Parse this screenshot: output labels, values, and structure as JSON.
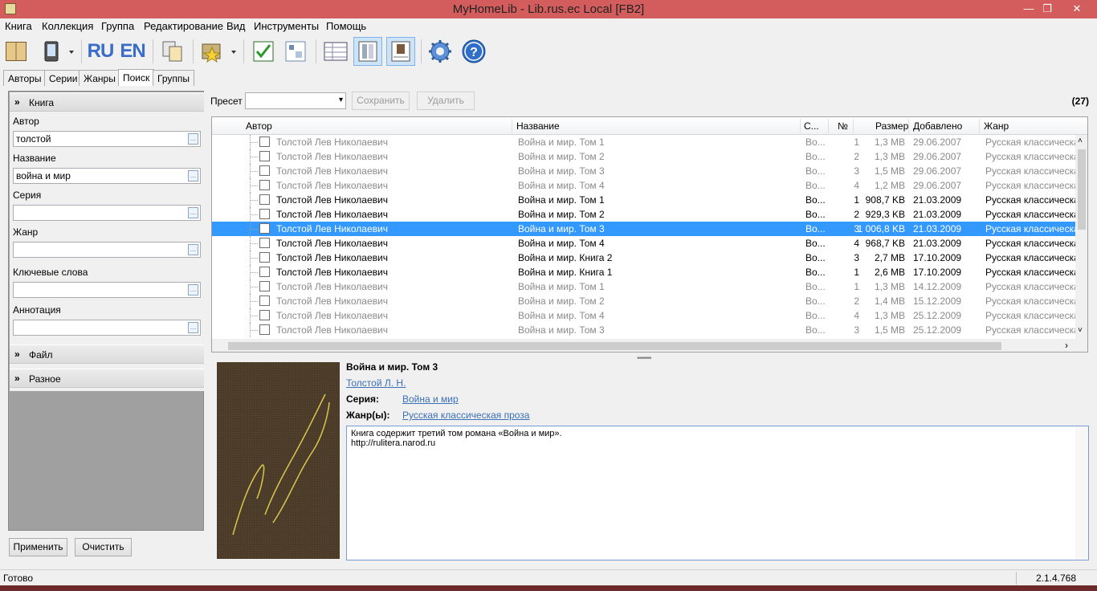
{
  "window": {
    "title": "MyHomeLib - Lib.rus.ec Local [FB2]",
    "btn_min": "—",
    "btn_max": "❐",
    "btn_close": "✕"
  },
  "menu": [
    "Книга",
    "Коллекция",
    "Группа",
    "Редактирование",
    "Вид",
    "Инструменты",
    "Помощь"
  ],
  "toolbar": {
    "lang_ru": "RU",
    "lang_en": "EN"
  },
  "tabs": [
    "Авторы",
    "Серии",
    "Жанры",
    "Поиск",
    "Группы"
  ],
  "search_panel": {
    "section_book": "Книга",
    "fields": [
      {
        "label": "Автор",
        "value": "толстой"
      },
      {
        "label": "Название",
        "value": "война и мир"
      },
      {
        "label": "Серия",
        "value": ""
      },
      {
        "label": "Жанр",
        "value": ""
      },
      {
        "label": "Ключевые слова",
        "value": ""
      },
      {
        "label": "Аннотация",
        "value": ""
      }
    ],
    "section_file": "Файл",
    "section_misc": "Разное",
    "apply": "Применить",
    "clear": "Очистить"
  },
  "preset": {
    "label": "Пресет",
    "value": "",
    "save": "Сохранить",
    "delete": "Удалить",
    "count": "(27)"
  },
  "grid": {
    "columns": [
      "Автор",
      "Название",
      "С...",
      "№",
      "Размер",
      "Добавлено",
      "Жанр"
    ],
    "rows": [
      {
        "author": "Толстой Лев Николаевич",
        "title": "Война и мир. Том 1",
        "series": "Во...",
        "no": "1",
        "size": "1,3 MB",
        "added": "29.06.2007",
        "genre": "Русская классическая",
        "state": "dim"
      },
      {
        "author": "Толстой Лев Николаевич",
        "title": "Война и мир. Том 2",
        "series": "Во...",
        "no": "2",
        "size": "1,3 MB",
        "added": "29.06.2007",
        "genre": "Русская классическая",
        "state": "dim"
      },
      {
        "author": "Толстой Лев Николаевич",
        "title": "Война и мир. Том 3",
        "series": "Во...",
        "no": "3",
        "size": "1,5 MB",
        "added": "29.06.2007",
        "genre": "Русская классическая",
        "state": "dim"
      },
      {
        "author": "Толстой Лев Николаевич",
        "title": "Война и мир. Том 4",
        "series": "Во...",
        "no": "4",
        "size": "1,2 MB",
        "added": "29.06.2007",
        "genre": "Русская классическая",
        "state": "dim"
      },
      {
        "author": "Толстой Лев Николаевич",
        "title": "Война и мир. Том 1",
        "series": "Во...",
        "no": "1",
        "size": "908,7 KB",
        "added": "21.03.2009",
        "genre": "Русская классическая",
        "state": "ok"
      },
      {
        "author": "Толстой Лев Николаевич",
        "title": "Война и мир. Том 2",
        "series": "Во...",
        "no": "2",
        "size": "929,3 KB",
        "added": "21.03.2009",
        "genre": "Русская классическая",
        "state": "ok"
      },
      {
        "author": "Толстой Лев Николаевич",
        "title": "Война и мир. Том 3",
        "series": "Во...",
        "no": "3",
        "size": "1 006,8 KB",
        "added": "21.03.2009",
        "genre": "Русская классическая",
        "state": "sel"
      },
      {
        "author": "Толстой Лев Николаевич",
        "title": "Война и мир. Том 4",
        "series": "Во...",
        "no": "4",
        "size": "968,7 KB",
        "added": "21.03.2009",
        "genre": "Русская классическая",
        "state": "ok"
      },
      {
        "author": "Толстой Лев Николаевич",
        "title": "Война и мир. Книга 2",
        "series": "Во...",
        "no": "3",
        "size": "2,7 MB",
        "added": "17.10.2009",
        "genre": "Русская классическая",
        "state": "ok"
      },
      {
        "author": "Толстой Лев Николаевич",
        "title": "Война и мир. Книга 1",
        "series": "Во...",
        "no": "1",
        "size": "2,6 MB",
        "added": "17.10.2009",
        "genre": "Русская классическая",
        "state": "ok"
      },
      {
        "author": "Толстой Лев Николаевич",
        "title": "Война и мир. Том 1",
        "series": "Во...",
        "no": "1",
        "size": "1,3 MB",
        "added": "14.12.2009",
        "genre": "Русская классическая",
        "state": "dim"
      },
      {
        "author": "Толстой Лев Николаевич",
        "title": "Война и мир. Том 2",
        "series": "Во...",
        "no": "2",
        "size": "1,4 MB",
        "added": "15.12.2009",
        "genre": "Русская классическая",
        "state": "dim"
      },
      {
        "author": "Толстой Лев Николаевич",
        "title": "Война и мир. Том 4",
        "series": "Во...",
        "no": "4",
        "size": "1,3 MB",
        "added": "25.12.2009",
        "genre": "Русская классическая",
        "state": "dim"
      },
      {
        "author": "Толстой Лев Николаевич",
        "title": "Война и мир. Том 3",
        "series": "Во...",
        "no": "3",
        "size": "1,5 MB",
        "added": "25.12.2009",
        "genre": "Русская классическая",
        "state": "dim"
      }
    ]
  },
  "details": {
    "title": "Война и мир. Том 3",
    "author_link": "Толстой Л. Н.",
    "series_label": "Серия:",
    "series_value": "Война и мир",
    "genre_label": "Жанр(ы):",
    "genre_value": "Русская классическая проза",
    "annotation_line1": "Книга содержит третий том романа «Война и мир».",
    "annotation_line2": "http://rulitera.narod.ru"
  },
  "status": {
    "left": "Готово",
    "version": "2.1.4.768"
  },
  "colors": {
    "titlebar": "#d35d5d",
    "selection": "#3399ff",
    "link": "#3b6fb8"
  }
}
